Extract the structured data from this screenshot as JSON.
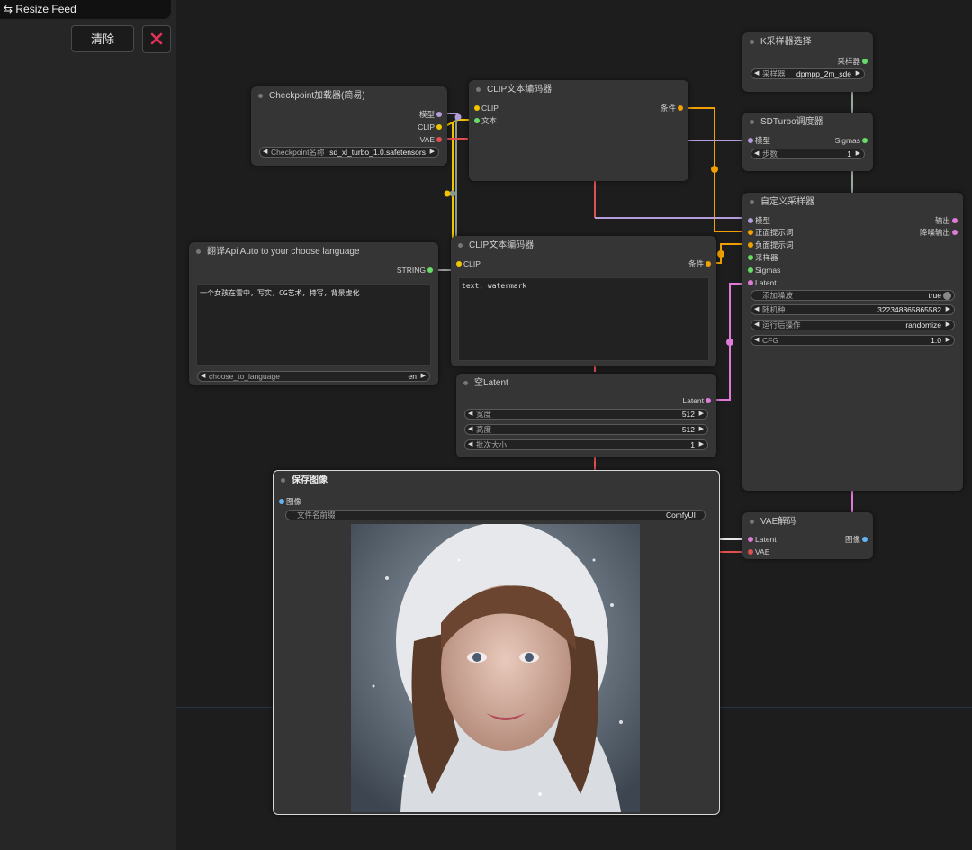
{
  "sidebar": {
    "title": "⇆ Resize Feed",
    "clear_label": "清除"
  },
  "colors": {
    "accent_red": "#e0335a"
  },
  "nodes": {
    "ksampler_select": {
      "title": "K采样器选择",
      "out_sampler": "采样器",
      "w_sampler": {
        "label": "采样器",
        "value": "dpmpp_2m_sde"
      }
    },
    "checkpoint": {
      "title": "Checkpoint加载器(简易)",
      "out_model": "模型",
      "out_clip": "CLIP",
      "out_vae": "VAE",
      "w_ckpt": {
        "label": "Checkpoint名称",
        "value": "sd_xl_turbo_1.0.safetensors"
      }
    },
    "clip_encode_1": {
      "title": "CLIP文本编码器",
      "in_clip": "CLIP",
      "in_text": "文本",
      "out_cond": "条件"
    },
    "sdturbo": {
      "title": "SDTurbo调度器",
      "in_model": "模型",
      "out_sigmas": "Sigmas",
      "w_steps": {
        "label": "步数",
        "value": "1"
      }
    },
    "custom_sampler": {
      "title": "自定义采样器",
      "inputs": [
        "模型",
        "正面提示词",
        "负面提示词",
        "采样器",
        "Sigmas",
        "Latent"
      ],
      "out_output": "输出",
      "out_denoised": "降噪输出",
      "w_add_noise": {
        "label": "添加噪波",
        "value": "true"
      },
      "w_seed": {
        "label": "随机种",
        "value": "322348865865582"
      },
      "w_after": {
        "label": "运行后操作",
        "value": "randomize"
      },
      "w_cfg": {
        "label": "CFG",
        "value": "1.0"
      }
    },
    "translate": {
      "title": "翻译Api  Auto to your choose language",
      "out_string": "STRING",
      "text": "一个女孩在雪中，写实，CG艺术，特写，背景虚化",
      "w_lang": {
        "label": "choose_to_language",
        "value": "en"
      }
    },
    "clip_encode_2": {
      "title": "CLIP文本编码器",
      "in_clip": "CLIP",
      "out_cond": "条件",
      "text": "text, watermark"
    },
    "empty_latent": {
      "title": "空Latent",
      "out_latent": "Latent",
      "w_width": {
        "label": "宽度",
        "value": "512"
      },
      "w_height": {
        "label": "高度",
        "value": "512"
      },
      "w_batch": {
        "label": "批次大小",
        "value": "1"
      }
    },
    "save_image": {
      "title": "保存图像",
      "in_image": "图像",
      "w_prefix": {
        "label": "文件名前缀",
        "value": "ComfyUI"
      }
    },
    "vae_decode": {
      "title": "VAE解码",
      "in_latent": "Latent",
      "in_vae": "VAE",
      "out_image": "图像"
    }
  }
}
